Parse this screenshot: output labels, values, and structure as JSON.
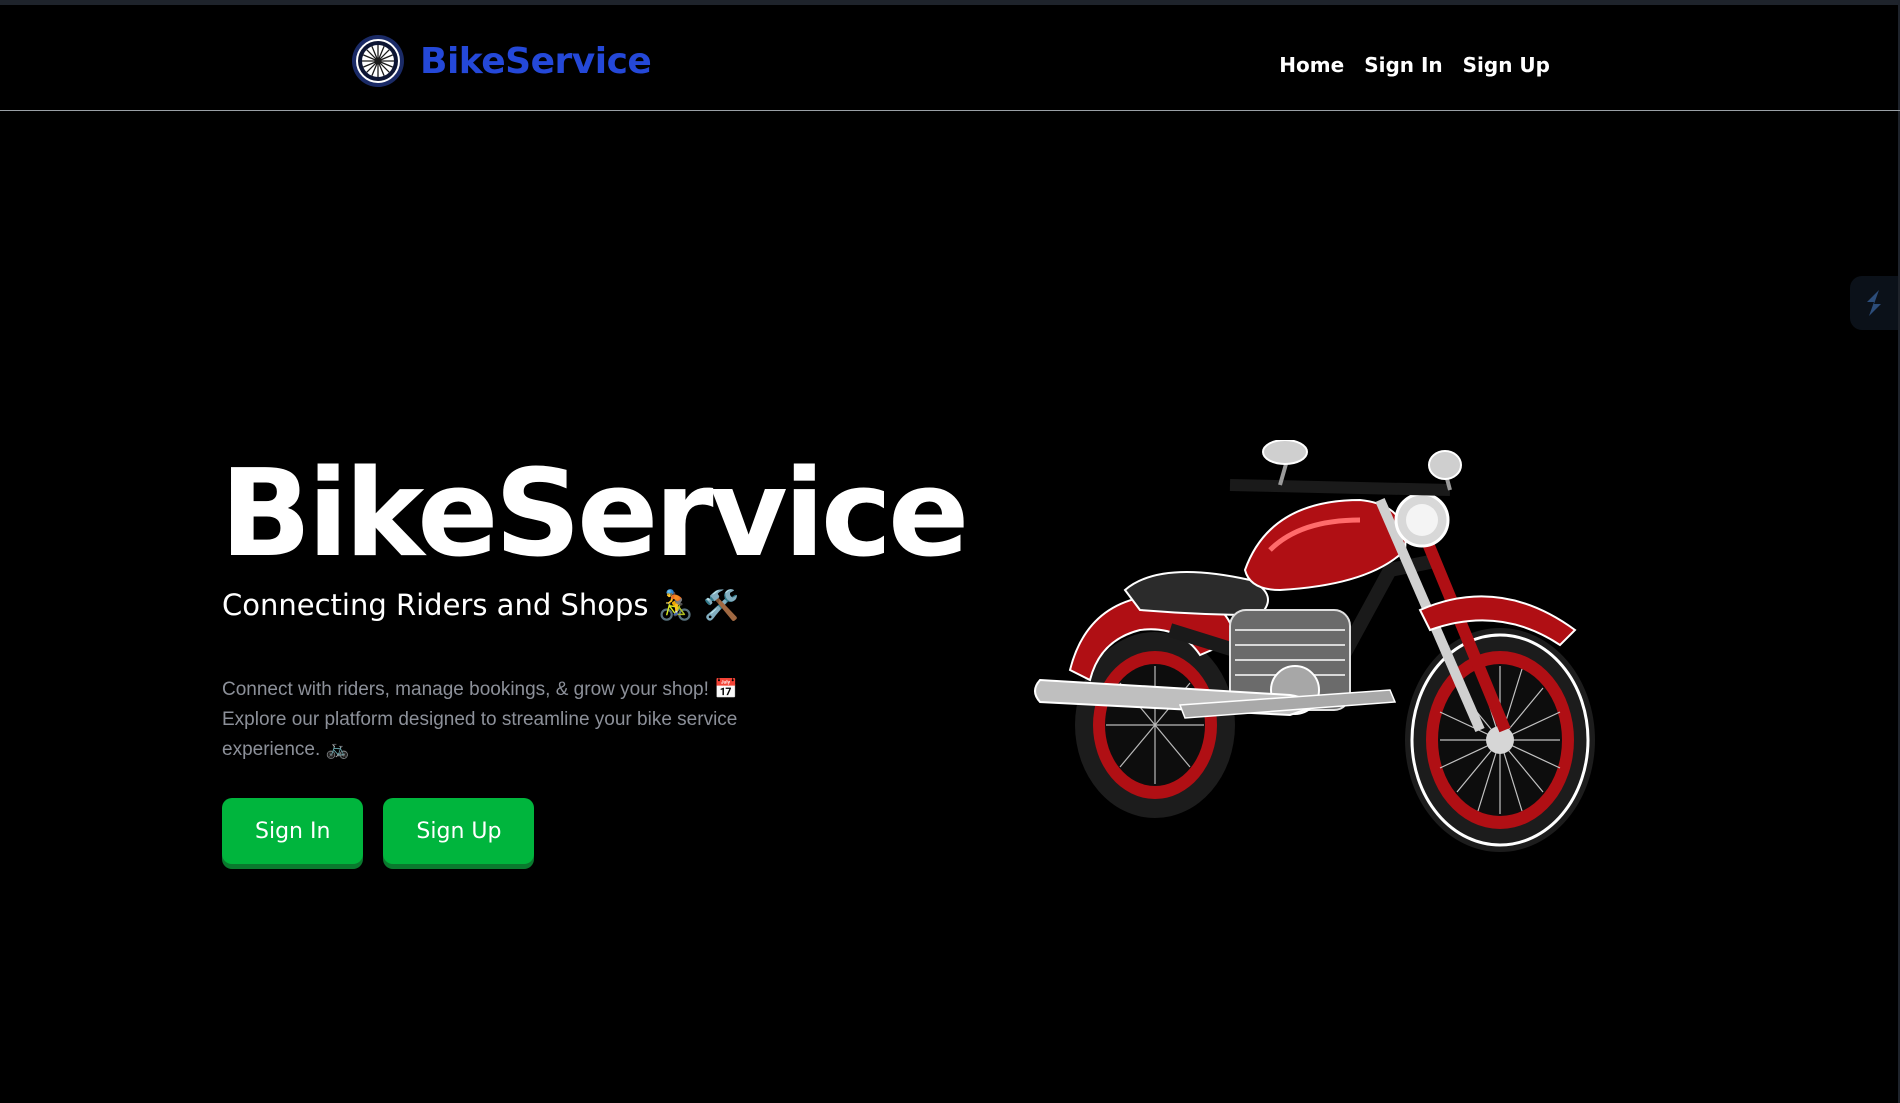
{
  "navbar": {
    "brand": "BikeService",
    "links": [
      "Home",
      "Sign In",
      "Sign Up"
    ]
  },
  "hero": {
    "title": "BikeService",
    "subtitle": "Connecting Riders and Shops 🚴 🛠️",
    "description": "Connect with riders, manage bookings, & grow your shop! 📅 Explore our platform designed to streamline your bike service experience. 🚲",
    "buttons": {
      "sign_in": "Sign In",
      "sign_up": "Sign Up"
    }
  },
  "colors": {
    "background": "#000000",
    "brand": "#2448d8",
    "accent_button": "#00b53d",
    "description_text": "#8c9099"
  },
  "icons": {
    "logo": "bike-wheel-icon",
    "side_widget": "extension-bolt-icon",
    "hero_image": "motorcycle-illustration"
  }
}
